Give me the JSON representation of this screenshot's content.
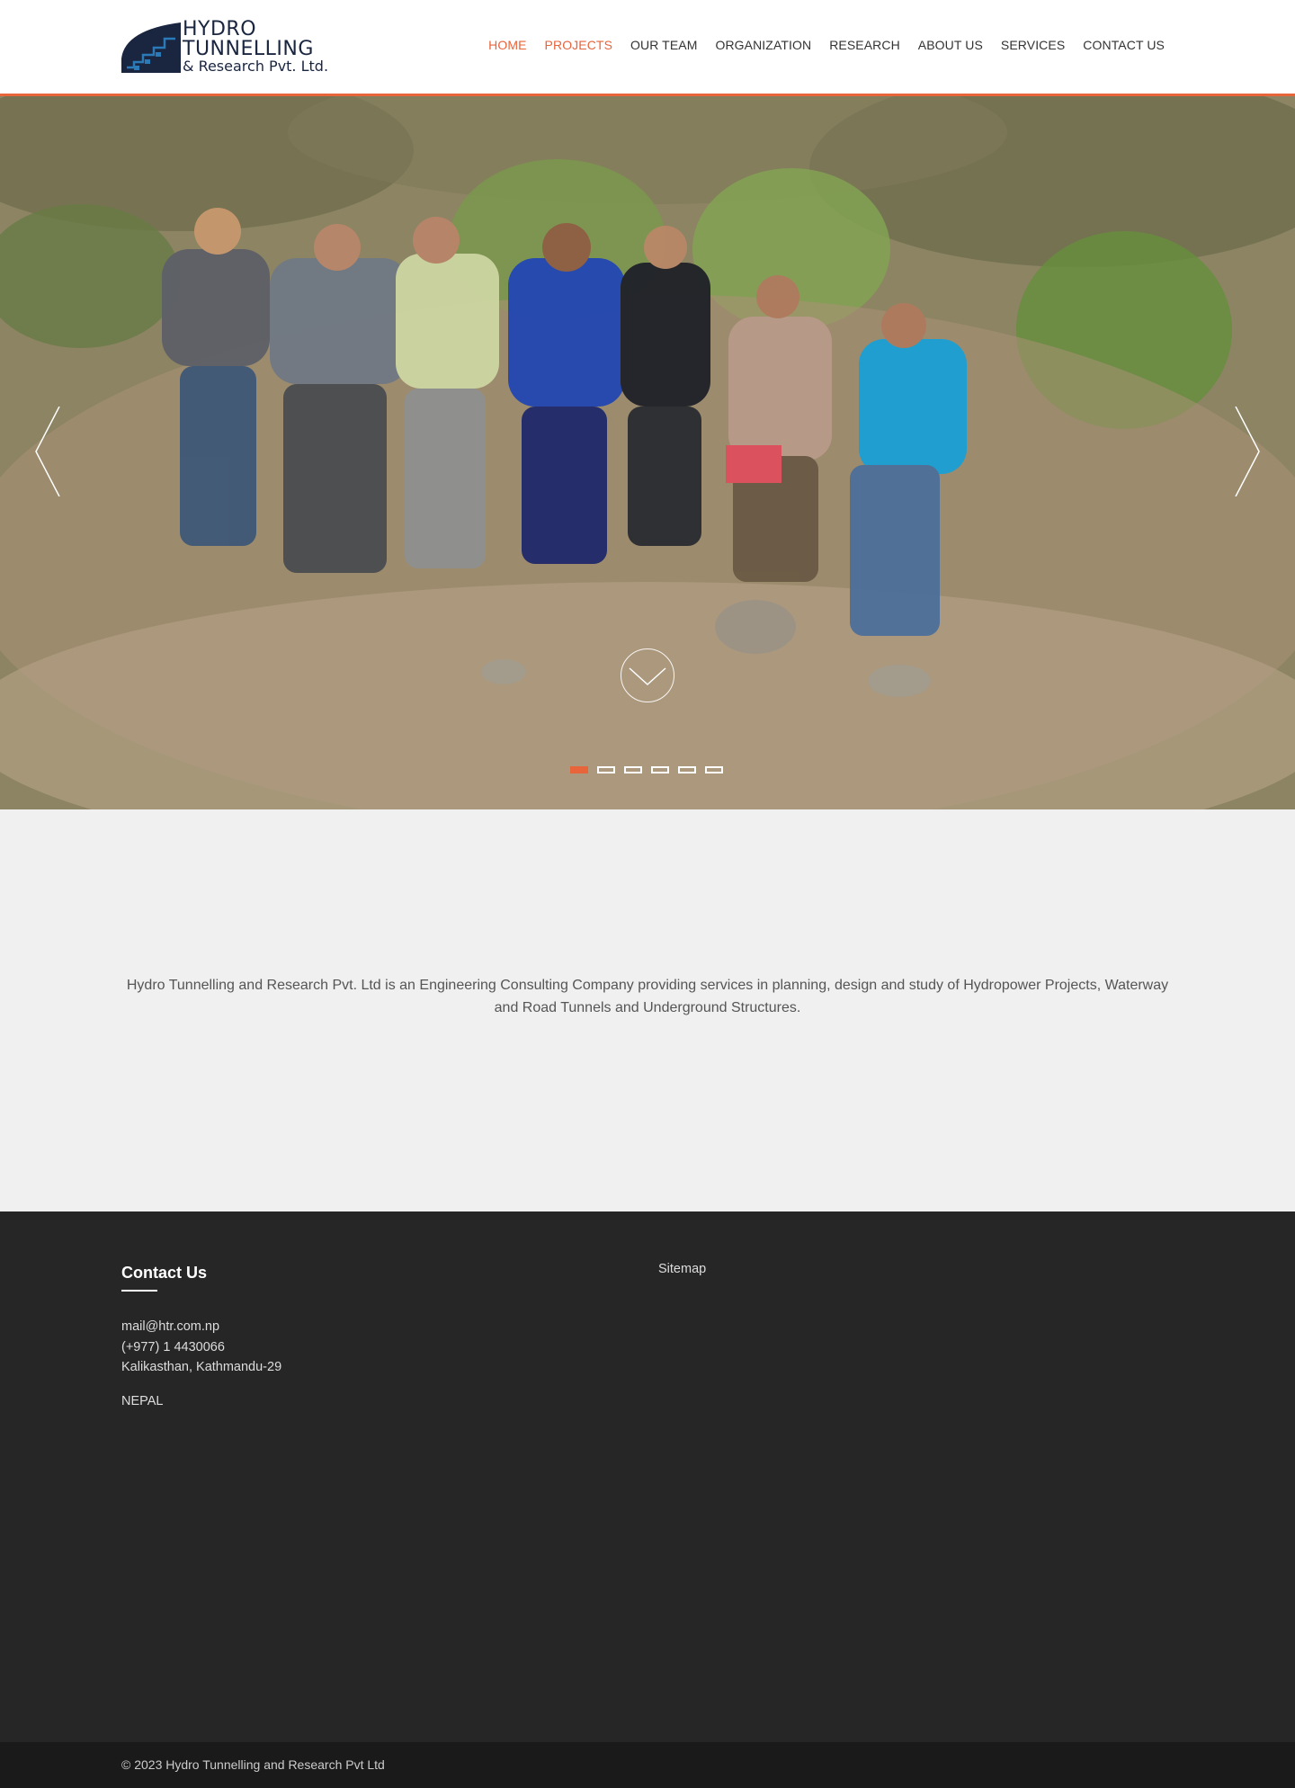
{
  "brand": {
    "line1": "HYDRO",
    "line2": "TUNNELLING",
    "line3": "& Research Pvt. Ltd.",
    "color_primary": "#1a2540",
    "accent": "#e8643b"
  },
  "nav": {
    "items": [
      {
        "label": "HOME",
        "active": true
      },
      {
        "label": "PROJECTS",
        "active": true
      },
      {
        "label": "OUR TEAM",
        "active": false
      },
      {
        "label": "ORGANIZATION",
        "active": false
      },
      {
        "label": "RESEARCH",
        "active": false
      },
      {
        "label": "ABOUT US",
        "active": false
      },
      {
        "label": "SERVICES",
        "active": false
      },
      {
        "label": "CONTACT US",
        "active": false
      }
    ]
  },
  "hero": {
    "prev_icon": "chevron-left-icon",
    "next_icon": "chevron-right-icon",
    "scroll_icon": "chevron-down-circle-icon",
    "slide_count": 6,
    "active_slide": 1
  },
  "intro": {
    "text": "Hydro Tunnelling and Research Pvt. Ltd is an Engineering Consulting Company providing services in planning, design and study of Hydropower Projects, Waterway and Road Tunnels and Underground Structures."
  },
  "footer": {
    "contact_title": "Contact Us",
    "email": "mail@htr.com.np",
    "phone": "(+977) 1 4430066",
    "address": "Kalikasthan, Kathmandu-29",
    "country": "NEPAL",
    "sitemap_label": "Sitemap",
    "copyright": "© 2023 Hydro Tunnelling and Research Pvt Ltd"
  }
}
